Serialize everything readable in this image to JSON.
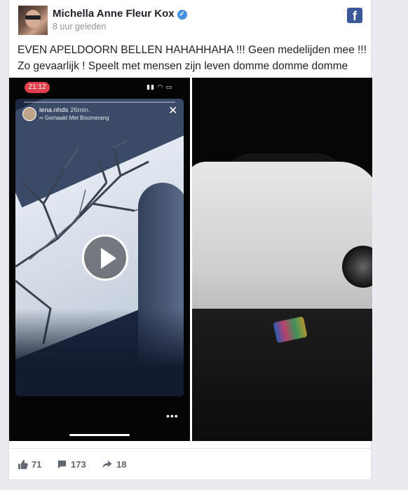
{
  "post": {
    "author": "Michella Anne Fleur Kox",
    "timestamp": "8 uur geleden",
    "text": "EVEN APELDOORN BELLEN HAHAHHAHA !!! Geen medelijden mee !!! Zo gevaarlijk ! Speelt met mensen zijn leven domme domme domme GEIT"
  },
  "phone_story": {
    "status_time": "21:12",
    "username": "lena.nhds",
    "ago": "26min.",
    "subtitle": "∞ Gemaakt Met Boomerang"
  },
  "stats": {
    "likes": "71",
    "comments": "173",
    "shares": "18"
  },
  "colors": {
    "page_bg": "#e9ebee",
    "facebook_blue": "#3b5998",
    "verified_blue": "#4a90e2",
    "story_time_red": "#e0404a"
  },
  "icons": [
    "verified-badge-icon",
    "facebook-logo-icon",
    "close-icon",
    "play-icon",
    "more-dots-icon",
    "like-icon",
    "comment-icon",
    "share-icon"
  ]
}
